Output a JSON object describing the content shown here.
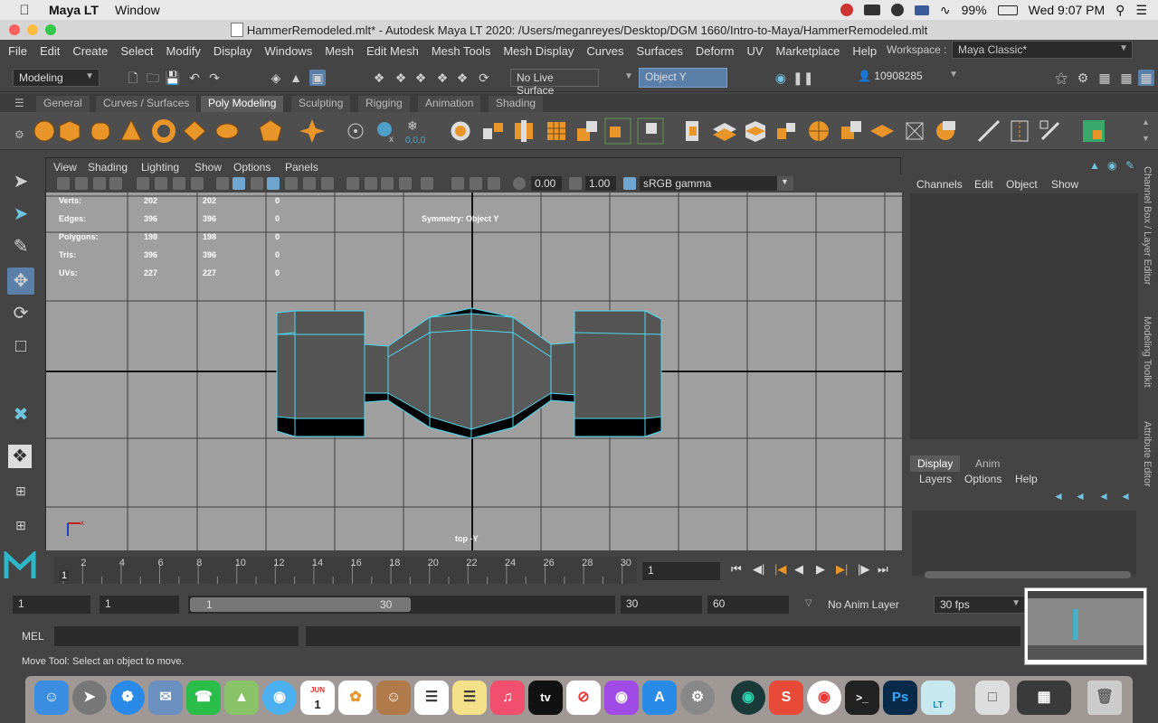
{
  "mac": {
    "app_name": "Maya LT",
    "menu_window": "Window",
    "battery": "99%",
    "clock": "Wed 9:07 PM"
  },
  "window": {
    "title": "HammerRemodeled.mlt* - Autodesk Maya LT 2020: /Users/meganreyes/Desktop/DGM 1660/Intro-to-Maya/HammerRemodeled.mlt"
  },
  "menus": [
    "File",
    "Edit",
    "Create",
    "Select",
    "Modify",
    "Display",
    "Windows",
    "Mesh",
    "Edit Mesh",
    "Mesh Tools",
    "Mesh Display",
    "Curves",
    "Surfaces",
    "Deform",
    "UV",
    "Marketplace",
    "Help"
  ],
  "workspace": {
    "label": "Workspace :",
    "value": "Maya Classic*"
  },
  "status": {
    "mode": "Modeling",
    "live_surface": "No Live Surface",
    "symmetry": "Object Y",
    "user_id": "10908285"
  },
  "shelf_tabs": [
    "General",
    "Curves / Surfaces",
    "Poly Modeling",
    "Sculpting",
    "Rigging",
    "Animation",
    "Shading"
  ],
  "shelf_active": "Poly Modeling",
  "panel_menus": [
    "View",
    "Shading",
    "Lighting",
    "Show",
    "Options",
    "Panels"
  ],
  "panel_fields": {
    "exposure": "0.00",
    "gamma": "1.00",
    "colorspace": "sRGB gamma"
  },
  "hud": {
    "rows": [
      {
        "label": "Verts:",
        "a": "202",
        "b": "202",
        "c": "0"
      },
      {
        "label": "Edges:",
        "a": "396",
        "b": "396",
        "c": "0"
      },
      {
        "label": "Polygons:",
        "a": "198",
        "b": "198",
        "c": "0"
      },
      {
        "label": "Tris:",
        "a": "396",
        "b": "396",
        "c": "0"
      },
      {
        "label": "UVs:",
        "a": "227",
        "b": "227",
        "c": "0"
      }
    ],
    "symmetry_label": "Symmetry: Object Y",
    "camera_label": "top -Y"
  },
  "channel_menus": [
    "Channels",
    "Edit",
    "Object",
    "Show"
  ],
  "layer_tabs": [
    "Display",
    "Anim"
  ],
  "layer_menus": [
    "Layers",
    "Options",
    "Help"
  ],
  "side_tabs": [
    "Channel Box / Layer Editor",
    "Modeling Toolkit",
    "Attribute Editor"
  ],
  "timeline": {
    "ticks": [
      "2",
      "4",
      "6",
      "8",
      "10",
      "12",
      "14",
      "16",
      "18",
      "20",
      "22",
      "24",
      "26",
      "28",
      "30"
    ],
    "current_frame_marker": "1",
    "current_frame_field": "1"
  },
  "range": {
    "start": "1",
    "playback_start": "1",
    "slider_start": "1",
    "slider_end": "30",
    "playback_end": "30",
    "end": "60",
    "anim_layer": "No Anim Layer",
    "fps": "30 fps"
  },
  "mel_label": "MEL",
  "help_line": "Move Tool: Select an object to move.",
  "dock_icons": [
    "finder",
    "launchpad",
    "safari",
    "mail-app",
    "facetime",
    "maps",
    "messages",
    "calendar",
    "photos",
    "contacts",
    "reminders",
    "notes",
    "music",
    "apple-tv",
    "news",
    "podcasts",
    "app-store",
    "system-preferences",
    "gitkraken",
    "scratch",
    "chrome",
    "terminal",
    "photoshop",
    "maya",
    "preview",
    "downloads",
    "trash"
  ],
  "calendar_month": "JUN",
  "calendar_day": "1",
  "appletv_label": "tv",
  "photoshop_label": "Ps",
  "maya_label": "LT"
}
